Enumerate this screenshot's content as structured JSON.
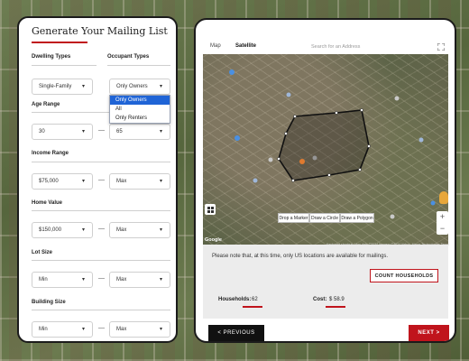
{
  "form": {
    "title": "Generate Your Mailing List",
    "dwelling_types": {
      "label": "Dwelling Types",
      "value": "Single-Family"
    },
    "occupant_types": {
      "label": "Occupant Types",
      "value": "Only Owners",
      "options": [
        "Only Owners",
        "All",
        "Only Renters"
      ]
    },
    "age_range": {
      "label": "Age Range",
      "min": "30",
      "max": "65"
    },
    "income_range": {
      "label": "Income Range",
      "min": "$75,000",
      "max": "Max"
    },
    "home_value": {
      "label": "Home Value",
      "min": "$150,000",
      "max": "Max"
    },
    "lot_size": {
      "label": "Lot Size",
      "min": "Min",
      "max": "Max"
    },
    "building_size": {
      "label": "Building Size",
      "min": "Min",
      "max": "Max"
    },
    "range_separator": "—"
  },
  "map": {
    "tabs": [
      "Map",
      "Satellite"
    ],
    "active_tab": "Satellite",
    "search_placeholder": "Search for an Address",
    "draw_buttons": [
      "Drop a Marker",
      "Draw a Circle",
      "Draw a Polygon"
    ],
    "google_label": "Google",
    "attribution": "Keyboard shortcuts   Map data ©2024 Imagery ©2024 Airbus, Maxar Technologies   Terms"
  },
  "results": {
    "note": "Please note that, at this time, only US locations are available for mailings.",
    "count_button": "COUNT HOUSEHOLDS",
    "households_label": "Households:",
    "households_value": "62",
    "cost_label": "Cost:",
    "cost_value": "$ 58.9"
  },
  "nav": {
    "previous": "<   PREVIOUS",
    "next": "NEXT   >"
  },
  "colors": {
    "accent": "#c0141c",
    "dropdown_highlight": "#1f64d6"
  }
}
